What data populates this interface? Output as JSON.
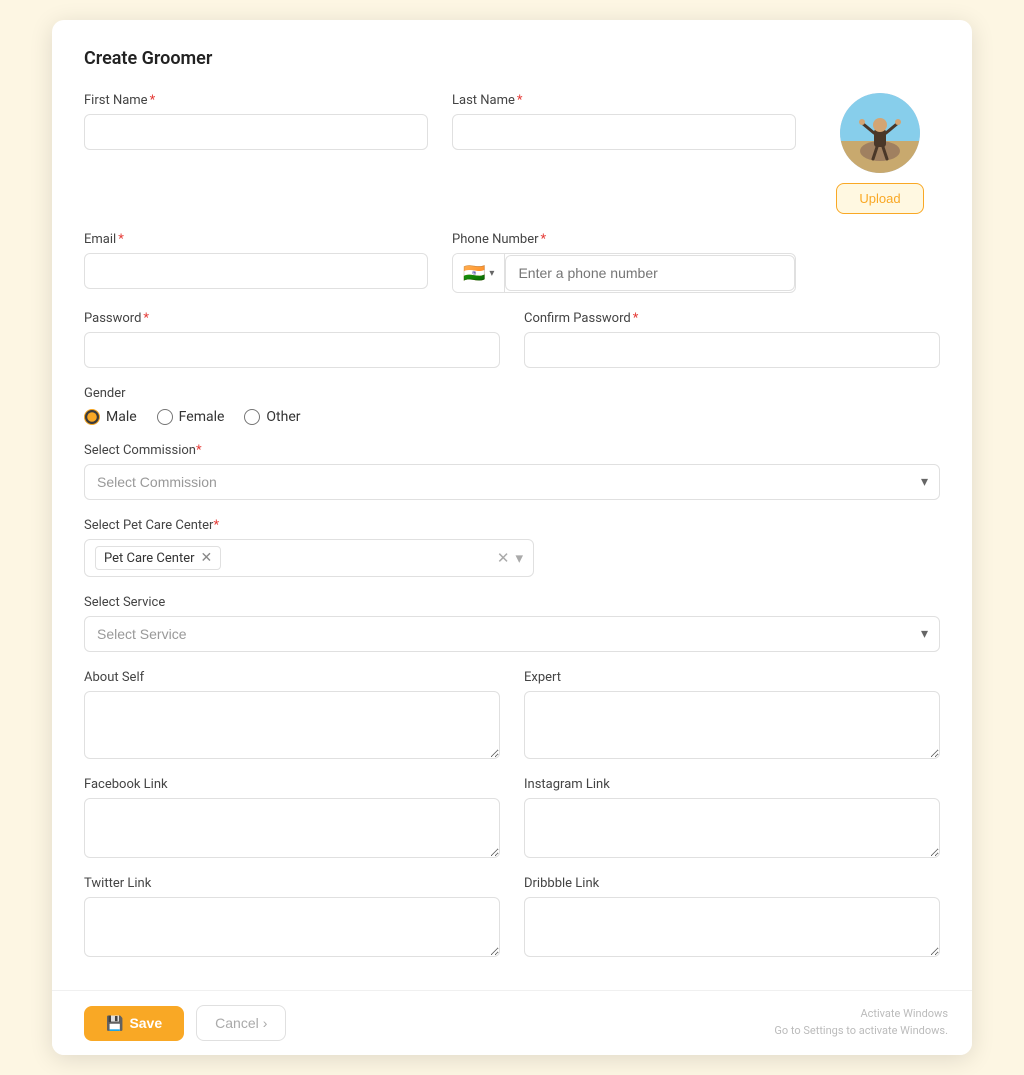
{
  "page": {
    "title": "Create Groomer",
    "background": "#fdf6e3"
  },
  "form": {
    "first_name_label": "First Name",
    "last_name_label": "Last Name",
    "email_label": "Email",
    "phone_label": "Phone Number",
    "phone_placeholder": "Enter a phone number",
    "phone_flag": "🇮🇳",
    "password_label": "Password",
    "confirm_password_label": "Confirm Password",
    "gender_label": "Gender",
    "gender_options": [
      "Male",
      "Female",
      "Other"
    ],
    "gender_selected": "Male",
    "select_commission_label": "Select Commission",
    "select_commission_placeholder": "Select Commission",
    "select_pet_care_label": "Select Pet Care Center",
    "pet_care_tag": "Pet Care Center",
    "select_service_label": "Select Service",
    "select_service_placeholder": "Select Service",
    "about_self_label": "About Self",
    "expert_label": "Expert",
    "facebook_label": "Facebook Link",
    "instagram_label": "Instagram Link",
    "twitter_label": "Twitter Link",
    "dribbble_label": "Dribbble Link",
    "upload_label": "Upload",
    "save_label": "Save",
    "cancel_label": "Cancel"
  },
  "windows": {
    "line1": "Activate Windows",
    "line2": "Go to Settings to activate Windows."
  }
}
